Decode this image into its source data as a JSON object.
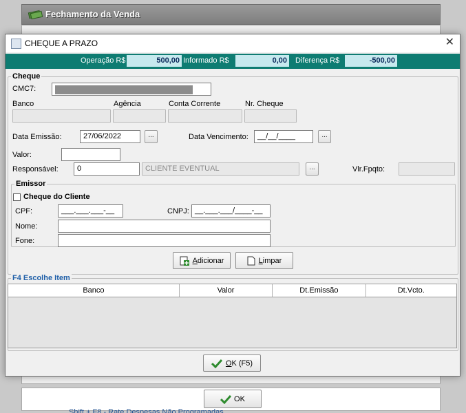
{
  "background": {
    "header_title": "Fechamento da Venda",
    "ok_label": "OK",
    "hint_text": "Shift + F8 - Rate Despesas Não Programadas"
  },
  "dialog": {
    "title": "CHEQUE A PRAZO",
    "close": "✕"
  },
  "summary": {
    "operacao_label": "Operação  R$",
    "operacao_value": "500,00",
    "informado_label": "Informado  R$",
    "informado_value": "0,00",
    "diferenca_label": "Diferença  R$",
    "diferenca_value": "-500,00",
    "bar_color": "#0e7c72"
  },
  "cheque": {
    "legend": "Cheque",
    "cmc7_label": "CMC7:",
    "banco_label": "Banco",
    "agencia_label": "Agência",
    "conta_label": "Conta Corrente",
    "nr_cheque_label": "Nr. Cheque",
    "data_emissao_label": "Data Emissão:",
    "data_emissao_value": "27/06/2022",
    "data_vencimento_label": "Data Vencimento:",
    "data_vencimento_value": "__/__/____",
    "ellipsis": "...",
    "valor_label": "Valor:",
    "responsavel_label": "Responsável:",
    "responsavel_value": "0",
    "responsavel_nome": "CLIENTE EVENTUAL",
    "vlr_fpqto_label": "Vlr.Fpqto:"
  },
  "emissor": {
    "legend": "Emissor",
    "cheque_cliente_label": "Cheque do Cliente",
    "cpf_label": "CPF:",
    "cpf_value": "___.___.___-__",
    "cnpj_label": "CNPJ:",
    "cnpj_value": "__.___.___/____-__",
    "nome_label": "Nome:",
    "fone_label": "Fone:"
  },
  "actions": {
    "adicionar_prefix": "A",
    "adicionar_rest": "dicionar",
    "limpar_prefix": "L",
    "limpar_rest": "impar"
  },
  "items": {
    "legend": "F4 Escolhe Item",
    "columns": [
      "Banco",
      "Valor",
      "Dt.Emissão",
      "Dt.Vcto."
    ]
  },
  "footer": {
    "ok_prefix": "O",
    "ok_rest": "K (F5)"
  }
}
